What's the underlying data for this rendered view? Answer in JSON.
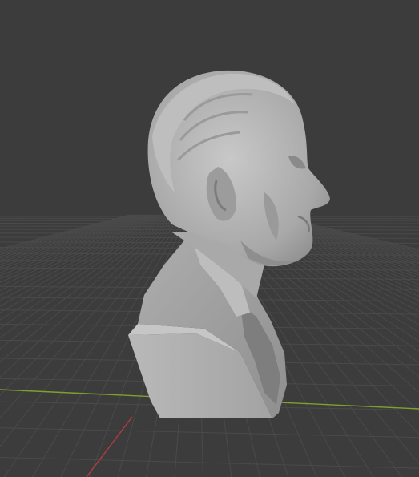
{
  "viewport": {
    "background": "#3c3c3c",
    "grid_color": "#4a4a4a",
    "x_axis_color": "#7ea12c",
    "y_axis_color": "#b53a44"
  },
  "model": {
    "name": "sculpted-bust",
    "material_color": "#b4b4b4"
  }
}
